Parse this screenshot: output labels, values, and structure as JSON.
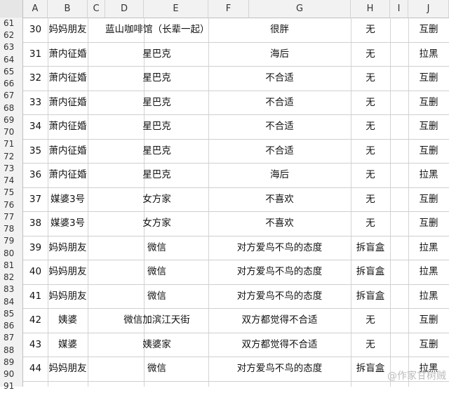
{
  "columns": [
    "A",
    "B",
    "C",
    "D",
    "E",
    "F",
    "G",
    "H",
    "I",
    "J"
  ],
  "row_numbers": [
    61,
    62,
    63,
    64,
    65,
    66,
    67,
    68,
    69,
    70,
    71,
    72,
    73,
    74,
    75,
    76,
    77,
    78,
    79,
    80,
    81,
    82,
    83,
    84,
    85,
    86,
    87,
    88,
    89,
    90,
    91
  ],
  "records": [
    {
      "n": "30",
      "b": "妈妈朋友",
      "e": "蓝山咖啡馆（长辈一起）",
      "g": "很胖",
      "h": "无",
      "j": "互删"
    },
    {
      "n": "31",
      "b": "萧内征婚",
      "e": "星巴克",
      "g": "海后",
      "h": "无",
      "j": "拉黑"
    },
    {
      "n": "32",
      "b": "萧内征婚",
      "e": "星巴克",
      "g": "不合适",
      "h": "无",
      "j": "互删"
    },
    {
      "n": "33",
      "b": "萧内征婚",
      "e": "星巴克",
      "g": "不合适",
      "h": "无",
      "j": "互删"
    },
    {
      "n": "34",
      "b": "萧内征婚",
      "e": "星巴克",
      "g": "不合适",
      "h": "无",
      "j": "互删"
    },
    {
      "n": "35",
      "b": "萧内征婚",
      "e": "星巴克",
      "g": "不合适",
      "h": "无",
      "j": "互删"
    },
    {
      "n": "36",
      "b": "萧内征婚",
      "e": "星巴克",
      "g": "海后",
      "h": "无",
      "j": "拉黑"
    },
    {
      "n": "37",
      "b": "媒婆3号",
      "e": "女方家",
      "g": "不喜欢",
      "h": "无",
      "j": "互删"
    },
    {
      "n": "38",
      "b": "媒婆3号",
      "e": "女方家",
      "g": "不喜欢",
      "h": "无",
      "j": "互删"
    },
    {
      "n": "39",
      "b": "妈妈朋友",
      "e": "微信",
      "g": "对方爱鸟不鸟的态度",
      "h": "拆盲盒",
      "j": "拉黑"
    },
    {
      "n": "40",
      "b": "妈妈朋友",
      "e": "微信",
      "g": "对方爱鸟不鸟的态度",
      "h": "拆盲盒",
      "j": "拉黑"
    },
    {
      "n": "41",
      "b": "妈妈朋友",
      "e": "微信",
      "g": "对方爱鸟不鸟的态度",
      "h": "拆盲盒",
      "j": "拉黑"
    },
    {
      "n": "42",
      "b": "姨婆",
      "e": "微信加滨江天街",
      "g": "双方都觉得不合适",
      "h": "无",
      "j": "互删"
    },
    {
      "n": "43",
      "b": "媒婆",
      "e": "姨婆家",
      "g": "双方都觉得不合适",
      "h": "无",
      "j": "互删"
    },
    {
      "n": "44",
      "b": "妈妈朋友",
      "e": "微信",
      "g": "对方爱鸟不鸟的态度",
      "h": "拆盲盒",
      "j": "拉黑"
    }
  ],
  "watermark": "@作家甘树贼"
}
